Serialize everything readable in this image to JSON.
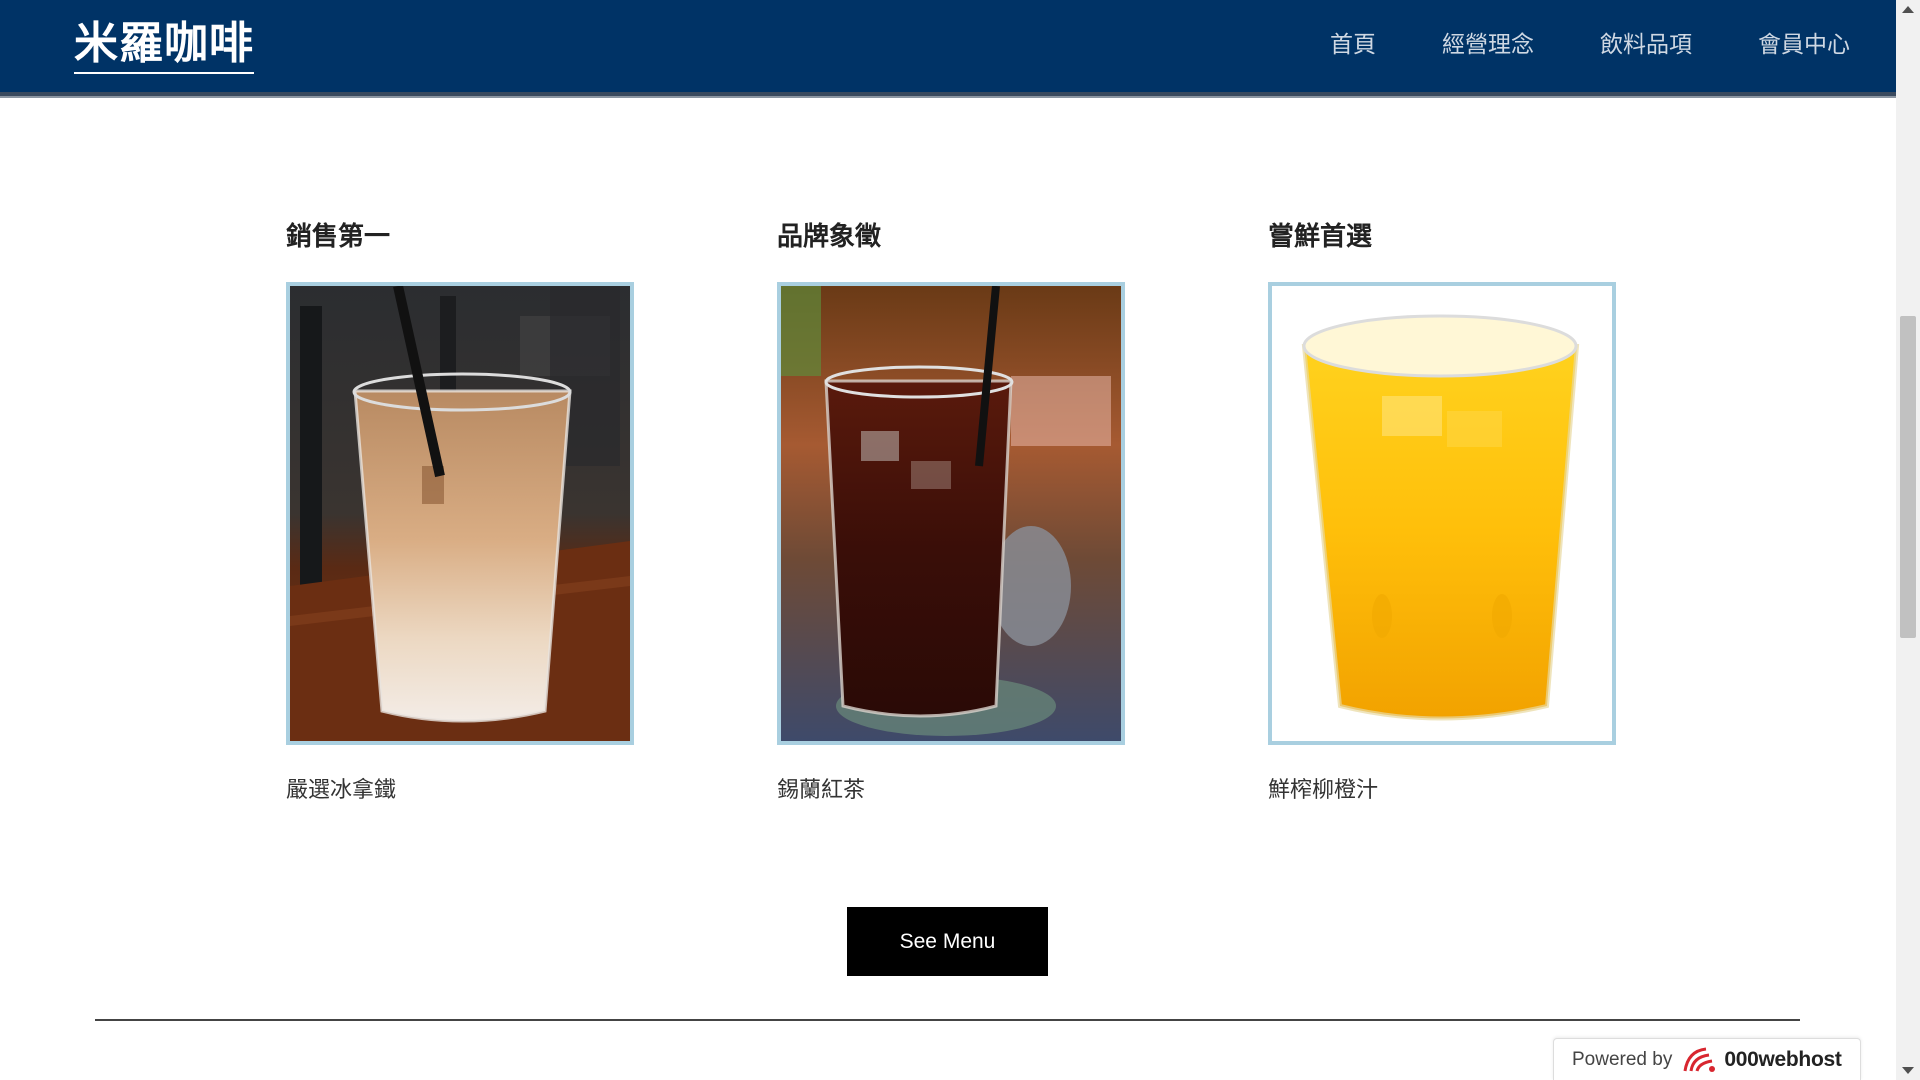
{
  "header": {
    "logo": "米羅咖啡",
    "nav": [
      "首頁",
      "經營理念",
      "飲料品項",
      "會員中心"
    ]
  },
  "products": [
    {
      "title": "銷售第一",
      "name": "嚴選冰拿鐵"
    },
    {
      "title": "品牌象徵",
      "name": "錫蘭紅茶"
    },
    {
      "title": "嘗鮮首選",
      "name": "鮮榨柳橙汁"
    }
  ],
  "button": {
    "label": "See Menu"
  },
  "powered": {
    "prefix": "Powered by",
    "brand": "000webhost"
  },
  "colors": {
    "header_bg": "#003366",
    "photo_border": "#a9cfe0",
    "button_bg": "#000000"
  }
}
